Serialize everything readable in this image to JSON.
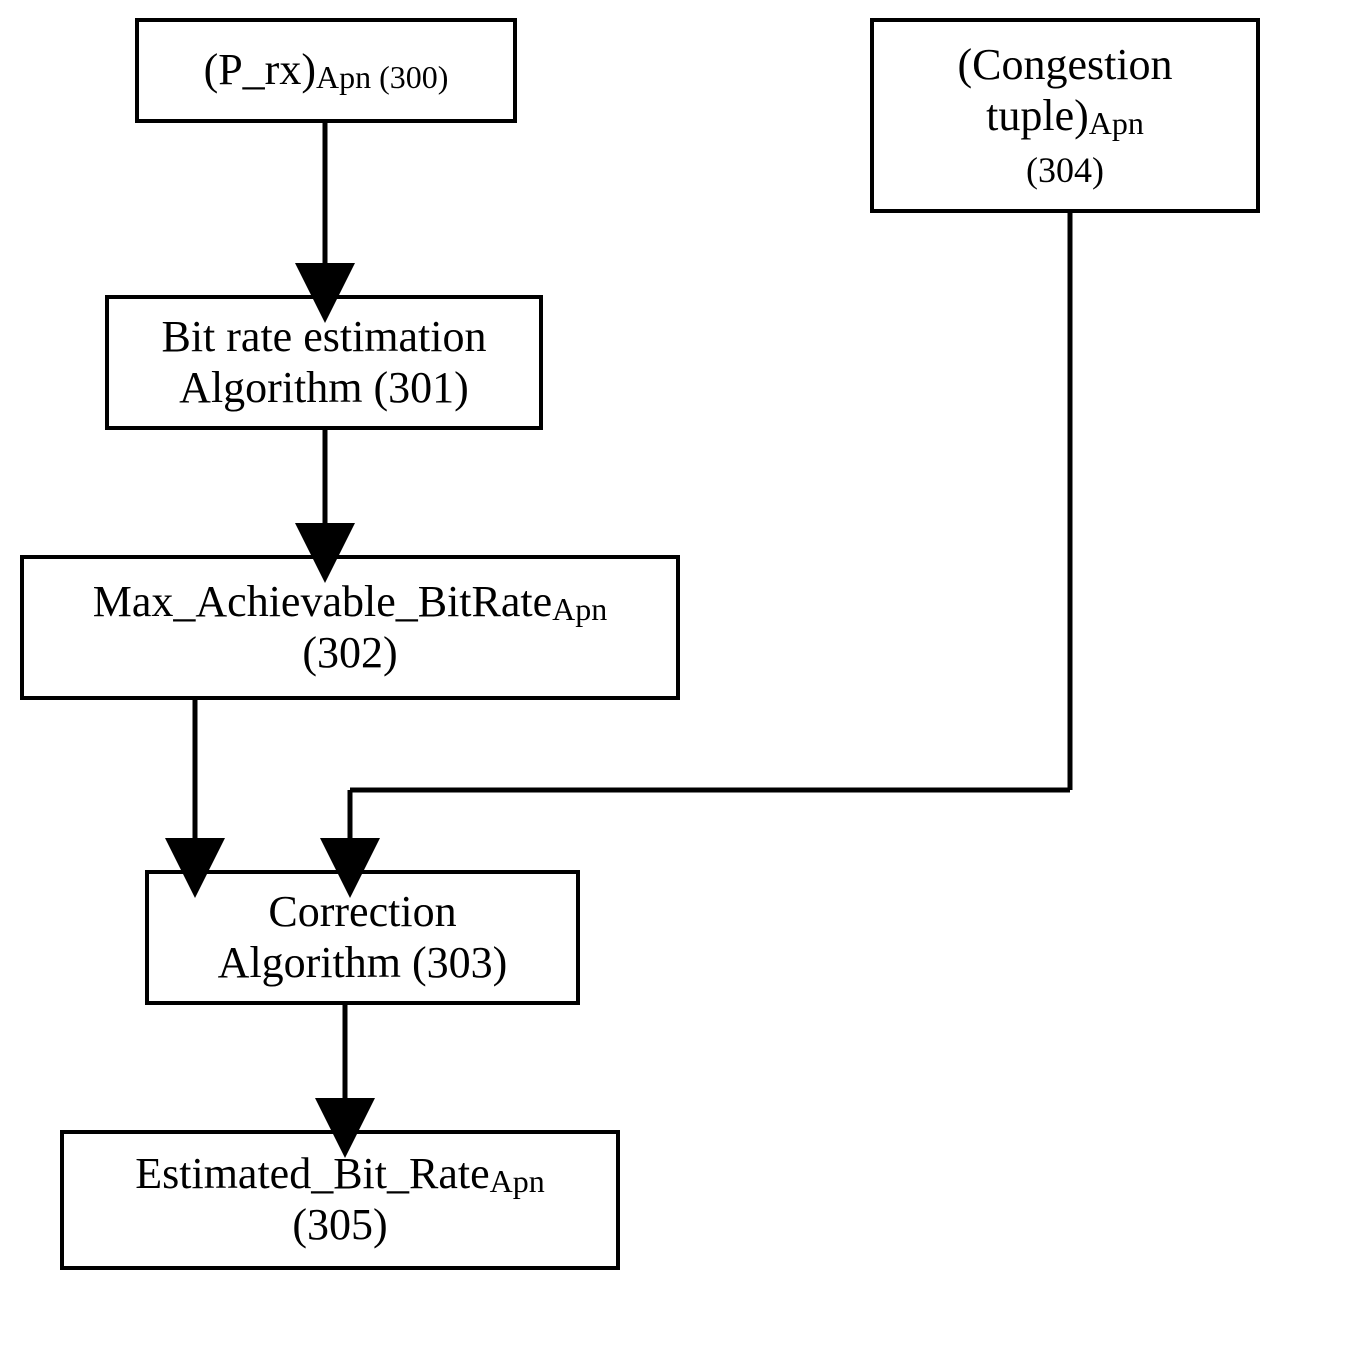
{
  "boxes": {
    "b300": {
      "line1_prefix": "(P_rx)",
      "line1_sub": "Apn (300)"
    },
    "b301": {
      "line1": "Bit rate estimation",
      "line2": "Algorithm (301)"
    },
    "b302": {
      "line1_prefix": "Max_Achievable_BitRate",
      "line1_sub": "Apn",
      "line2": "(302)"
    },
    "b303": {
      "line1": "Correction",
      "line2": "Algorithm (303)"
    },
    "b304": {
      "line1": "(Congestion",
      "line2_prefix": "tuple)",
      "line2_sub": "Apn",
      "line3": "(304)"
    },
    "b305": {
      "line1_prefix": "Estimated_Bit_Rate",
      "line1_sub": "Apn",
      "line2": "(305)"
    }
  }
}
